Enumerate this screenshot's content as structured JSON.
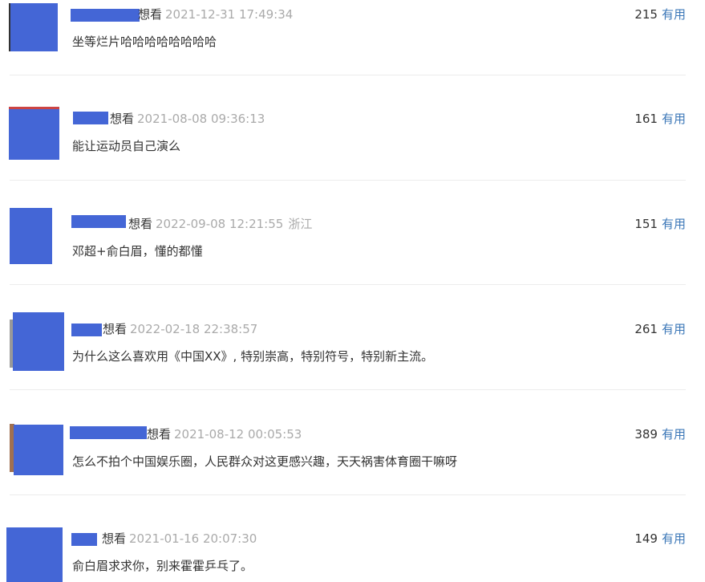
{
  "colors": {
    "avatar_mask": "#4466d6",
    "link": "#3d78b8",
    "muted": "#aaaaaa",
    "text": "#333333"
  },
  "comments": [
    {
      "action": "想看",
      "time": "2021-12-31 17:49:34",
      "location": "",
      "text": "坐等烂片哈哈哈哈哈哈哈哈",
      "votes": "215",
      "useful": "有用"
    },
    {
      "action": "想看",
      "time": "2021-08-08 09:36:13",
      "location": "",
      "text": "能让运动员自己演么",
      "votes": "161",
      "useful": "有用"
    },
    {
      "action": "想看",
      "time": "2022-09-08 12:21:55",
      "location": "浙江",
      "text": "邓超+俞白眉，懂的都懂",
      "votes": "151",
      "useful": "有用"
    },
    {
      "action": "想看",
      "time": "2022-02-18 22:38:57",
      "location": "",
      "text": "为什么这么喜欢用《中国XX》, 特别崇高，特别符号，特别新主流。",
      "votes": "261",
      "useful": "有用"
    },
    {
      "action": "想看",
      "time": "2021-08-12 00:05:53",
      "location": "",
      "text": "怎么不拍个中国娱乐圈，人民群众对这更感兴趣，天天祸害体育圈干嘛呀",
      "votes": "389",
      "useful": "有用"
    },
    {
      "action": "想看",
      "time": "2021-01-16 20:07:30",
      "location": "",
      "text": "俞白眉求求你，别来霍霍乒乓了。",
      "votes": "149",
      "useful": "有用"
    }
  ]
}
